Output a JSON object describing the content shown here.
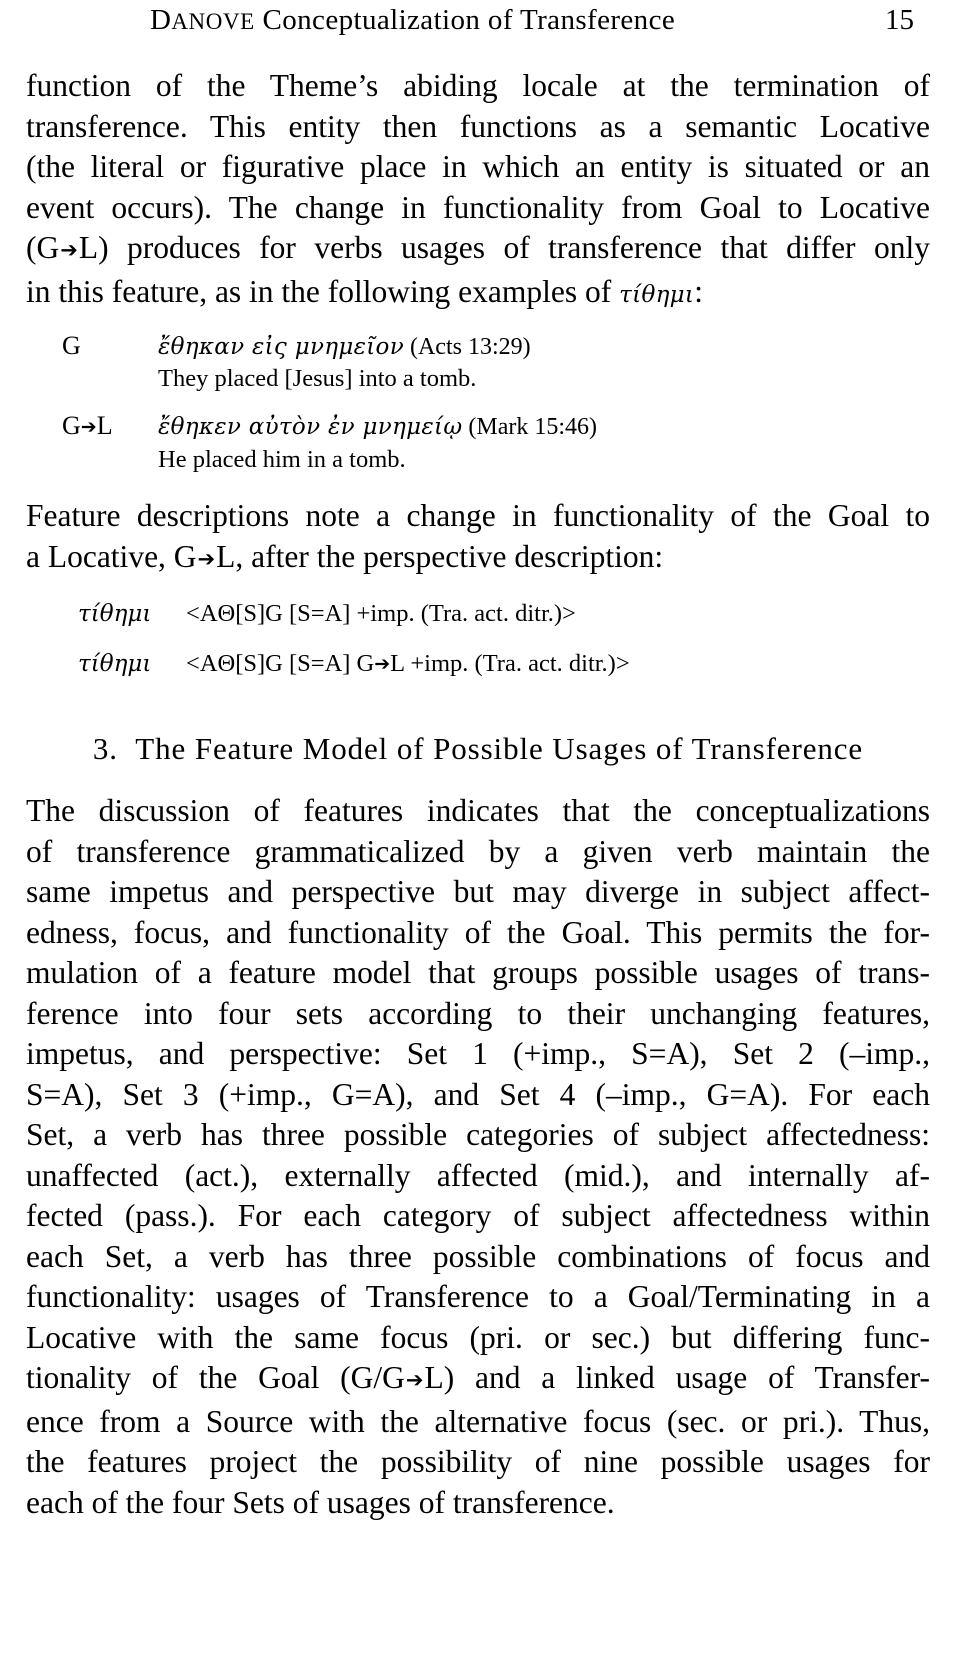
{
  "running_head": {
    "author_first_letter": "D",
    "author_rest": "ANOVE",
    "title": "Conceptualization of Transference",
    "page_number": "15"
  },
  "paragraphs": {
    "continued": {
      "lines": [
        "function of the Theme’s abiding locale at the termination of",
        "transference. This entity then functions as a semantic Locative",
        "(the literal or figurative place in which an entity is situated or an",
        "event occurs). The change in functionality from Goal to Locative",
        "(G➔L) produces for verbs usages of transference that differ only",
        "in this feature, as in the following examples of τίθημι:"
      ],
      "line1": "function of the Theme’s abiding locale at the termination of",
      "line2": "transference. This entity then functions as a semantic Locative",
      "line3": "(the literal or figurative place in which an entity is situated or an",
      "line4": "event occurs). The change in functionality from Goal to Locative",
      "line5_pre": "(G",
      "line5_post": "L) produces for verbs usages of transference that differ only",
      "line6_pre": "in this feature, as in the following examples of ",
      "line6_greek": "τίθημι",
      "line6_post": ":"
    },
    "feature_intro": {
      "line1": "Feature descriptions note a change in functionality of the Goal to",
      "line2_pre": "a Locative, G",
      "line2_post": "L, after the perspective description:"
    },
    "section3_body": {
      "lines": [
        "The discussion of features indicates that the conceptualizations",
        "of transference grammaticalized by a given verb maintain the",
        "same impetus and perspective but may diverge in subject affect-",
        "edness, focus, and functionality of the Goal. This permits the for-",
        "mulation of a feature model that groups possible usages of trans-",
        "ference into four sets according to their unchanging features,",
        "impetus, and perspective: Set 1 (+imp., S=A), Set 2 (–imp.,",
        "S=A), Set 3 (+imp., G=A), and Set 4 (–imp., G=A). For each",
        "Set, a verb has three possible categories of subject affectedness:",
        "unaffected (act.), externally affected (mid.), and internally af-",
        "fected (pass.). For each category of subject affectedness within",
        "each Set, a verb has three possible combinations of focus and",
        "functionality: usages of Transference to a Goal/Terminating in a",
        "Locative with the same focus (pri. or sec.) but differing func-",
        "tionality of the Goal (G/G➔L) and a linked usage of Transfer-",
        "ence from a Source with the alternative focus (sec. or pri.). Thus,",
        "the features project the possibility of nine possible usages for",
        "each of the four Sets of usages of transference."
      ],
      "l1": "The discussion of features indicates that the conceptualizations",
      "l2": "of transference grammaticalized by a given verb maintain the",
      "l3": "same impetus and perspective but may diverge in subject affect-",
      "l4": "edness, focus, and functionality of the Goal. This permits the for-",
      "l5": "mulation of a feature model that groups possible usages of trans-",
      "l6": "ference into four sets according to their unchanging features,",
      "l7": "impetus, and perspective: Set 1 (+imp., S=A), Set 2 (–imp.,",
      "l8": "S=A), Set 3 (+imp., G=A), and Set 4 (–imp., G=A). For each",
      "l9": "Set, a verb has three possible categories of subject affectedness:",
      "l10": "unaffected (act.), externally affected (mid.), and internally af-",
      "l11": "fected (pass.). For each category of subject affectedness within",
      "l12": "each Set, a verb has three possible combinations of focus and",
      "l13": "functionality: usages of Transference to a Goal/Terminating in a",
      "l14": "Locative with the same focus (pri. or sec.) but differing func-",
      "l15_pre": "tionality of the Goal (G/G",
      "l15_post": "L) and a linked usage of Transfer-",
      "l16": "ence from a Source with the alternative focus (sec. or pri.). Thus,",
      "l17": "the features project the possibility of nine possible usages for",
      "l18": "each of the four Sets of usages of transference."
    }
  },
  "examples": [
    {
      "label": "G",
      "greek": "ἔθηκαν εἰς μνημεῖον",
      "citation": "(Acts 13:29)",
      "gloss": "They placed [Jesus] into a tomb."
    },
    {
      "label_pre": "G",
      "label_post": "L",
      "greek": "ἔθηκεν αὐτὸν ἐν μνημείῳ",
      "citation": "(Mark 15:46)",
      "gloss": "He placed him in a tomb."
    }
  ],
  "feature_descriptions": [
    {
      "verb": "τίθημι",
      "description": "<AΘ[S]G [S=A] +imp. (Tra. act. ditr.)>"
    },
    {
      "verb": "τίθημι",
      "desc_pre": "<AΘ[S]G [S=A] G",
      "desc_post": "L +imp. (Tra. act. ditr.)>"
    }
  ],
  "section_heading": {
    "number": "3.",
    "text": "The Feature Model of Possible Usages of Transference",
    "full": "3.  The Feature Model of Possible Usages of Transference"
  },
  "glyphs": {
    "arrow": "➔"
  },
  "colors": {
    "text": "#000000",
    "background": "#ffffff"
  }
}
